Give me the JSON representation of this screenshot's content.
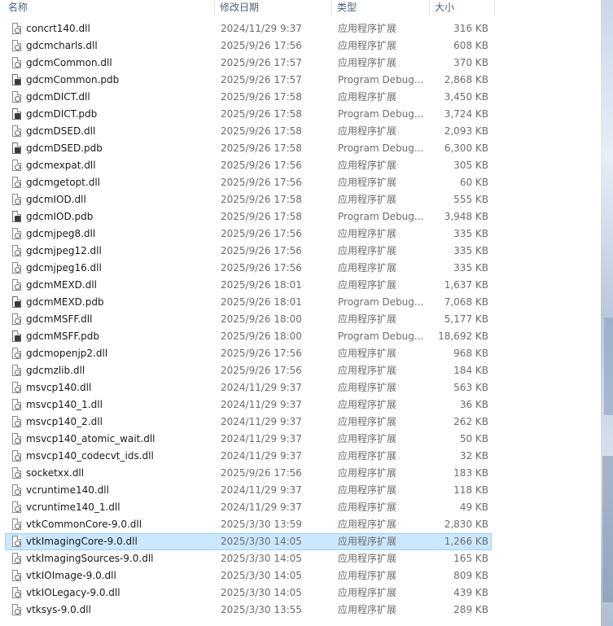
{
  "columns": {
    "name": "名称",
    "date": "修改日期",
    "type": "类型",
    "size": "大小"
  },
  "selected_index": 30,
  "files": [
    {
      "name": "concrt140.dll",
      "date": "2024/11/29 9:37",
      "type": "应用程序扩展",
      "size": "316 KB",
      "icon": "dll-file-icon"
    },
    {
      "name": "gdcmcharls.dll",
      "date": "2025/9/26 17:56",
      "type": "应用程序扩展",
      "size": "608 KB",
      "icon": "dll-file-icon"
    },
    {
      "name": "gdcmCommon.dll",
      "date": "2025/9/26 17:57",
      "type": "应用程序扩展",
      "size": "370 KB",
      "icon": "dll-file-icon"
    },
    {
      "name": "gdcmCommon.pdb",
      "date": "2025/9/26 17:57",
      "type": "Program Debug...",
      "size": "2,868 KB",
      "icon": "pdb-file-icon"
    },
    {
      "name": "gdcmDICT.dll",
      "date": "2025/9/26 17:58",
      "type": "应用程序扩展",
      "size": "3,450 KB",
      "icon": "dll-file-icon"
    },
    {
      "name": "gdcmDICT.pdb",
      "date": "2025/9/26 17:58",
      "type": "Program Debug...",
      "size": "3,724 KB",
      "icon": "pdb-file-icon"
    },
    {
      "name": "gdcmDSED.dll",
      "date": "2025/9/26 17:58",
      "type": "应用程序扩展",
      "size": "2,093 KB",
      "icon": "dll-file-icon"
    },
    {
      "name": "gdcmDSED.pdb",
      "date": "2025/9/26 17:58",
      "type": "Program Debug...",
      "size": "6,300 KB",
      "icon": "pdb-file-icon"
    },
    {
      "name": "gdcmexpat.dll",
      "date": "2025/9/26 17:56",
      "type": "应用程序扩展",
      "size": "305 KB",
      "icon": "dll-file-icon"
    },
    {
      "name": "gdcmgetopt.dll",
      "date": "2025/9/26 17:56",
      "type": "应用程序扩展",
      "size": "60 KB",
      "icon": "dll-file-icon"
    },
    {
      "name": "gdcmIOD.dll",
      "date": "2025/9/26 17:58",
      "type": "应用程序扩展",
      "size": "555 KB",
      "icon": "dll-file-icon"
    },
    {
      "name": "gdcmIOD.pdb",
      "date": "2025/9/26 17:58",
      "type": "Program Debug...",
      "size": "3,948 KB",
      "icon": "pdb-file-icon"
    },
    {
      "name": "gdcmjpeg8.dll",
      "date": "2025/9/26 17:56",
      "type": "应用程序扩展",
      "size": "335 KB",
      "icon": "dll-file-icon"
    },
    {
      "name": "gdcmjpeg12.dll",
      "date": "2025/9/26 17:56",
      "type": "应用程序扩展",
      "size": "335 KB",
      "icon": "dll-file-icon"
    },
    {
      "name": "gdcmjpeg16.dll",
      "date": "2025/9/26 17:56",
      "type": "应用程序扩展",
      "size": "335 KB",
      "icon": "dll-file-icon"
    },
    {
      "name": "gdcmMEXD.dll",
      "date": "2025/9/26 18:01",
      "type": "应用程序扩展",
      "size": "1,637 KB",
      "icon": "dll-file-icon"
    },
    {
      "name": "gdcmMEXD.pdb",
      "date": "2025/9/26 18:01",
      "type": "Program Debug...",
      "size": "7,068 KB",
      "icon": "pdb-file-icon"
    },
    {
      "name": "gdcmMSFF.dll",
      "date": "2025/9/26 18:00",
      "type": "应用程序扩展",
      "size": "5,177 KB",
      "icon": "dll-file-icon"
    },
    {
      "name": "gdcmMSFF.pdb",
      "date": "2025/9/26 18:00",
      "type": "Program Debug...",
      "size": "18,692 KB",
      "icon": "pdb-file-icon"
    },
    {
      "name": "gdcmopenjp2.dll",
      "date": "2025/9/26 17:56",
      "type": "应用程序扩展",
      "size": "968 KB",
      "icon": "dll-file-icon"
    },
    {
      "name": "gdcmzlib.dll",
      "date": "2025/9/26 17:56",
      "type": "应用程序扩展",
      "size": "184 KB",
      "icon": "dll-file-icon"
    },
    {
      "name": "msvcp140.dll",
      "date": "2024/11/29 9:37",
      "type": "应用程序扩展",
      "size": "563 KB",
      "icon": "dll-file-icon"
    },
    {
      "name": "msvcp140_1.dll",
      "date": "2024/11/29 9:37",
      "type": "应用程序扩展",
      "size": "36 KB",
      "icon": "dll-file-icon"
    },
    {
      "name": "msvcp140_2.dll",
      "date": "2024/11/29 9:37",
      "type": "应用程序扩展",
      "size": "262 KB",
      "icon": "dll-file-icon"
    },
    {
      "name": "msvcp140_atomic_wait.dll",
      "date": "2024/11/29 9:37",
      "type": "应用程序扩展",
      "size": "50 KB",
      "icon": "dll-file-icon"
    },
    {
      "name": "msvcp140_codecvt_ids.dll",
      "date": "2024/11/29 9:37",
      "type": "应用程序扩展",
      "size": "32 KB",
      "icon": "dll-file-icon"
    },
    {
      "name": "socketxx.dll",
      "date": "2025/9/26 17:56",
      "type": "应用程序扩展",
      "size": "183 KB",
      "icon": "dll-file-icon"
    },
    {
      "name": "vcruntime140.dll",
      "date": "2024/11/29 9:37",
      "type": "应用程序扩展",
      "size": "118 KB",
      "icon": "dll-file-icon"
    },
    {
      "name": "vcruntime140_1.dll",
      "date": "2024/11/29 9:37",
      "type": "应用程序扩展",
      "size": "49 KB",
      "icon": "dll-file-icon"
    },
    {
      "name": "vtkCommonCore-9.0.dll",
      "date": "2025/3/30 13:59",
      "type": "应用程序扩展",
      "size": "2,830 KB",
      "icon": "dll-file-icon"
    },
    {
      "name": "vtkImagingCore-9.0.dll",
      "date": "2025/3/30 14:05",
      "type": "应用程序扩展",
      "size": "1,266 KB",
      "icon": "dll-file-icon"
    },
    {
      "name": "vtkImagingSources-9.0.dll",
      "date": "2025/3/30 14:05",
      "type": "应用程序扩展",
      "size": "165 KB",
      "icon": "dll-file-icon"
    },
    {
      "name": "vtkIOImage-9.0.dll",
      "date": "2025/3/30 14:05",
      "type": "应用程序扩展",
      "size": "809 KB",
      "icon": "dll-file-icon"
    },
    {
      "name": "vtkIOLegacy-9.0.dll",
      "date": "2025/3/30 14:05",
      "type": "应用程序扩展",
      "size": "439 KB",
      "icon": "dll-file-icon"
    },
    {
      "name": "vtksys-9.0.dll",
      "date": "2025/3/30 13:55",
      "type": "应用程序扩展",
      "size": "289 KB",
      "icon": "dll-file-icon"
    }
  ]
}
